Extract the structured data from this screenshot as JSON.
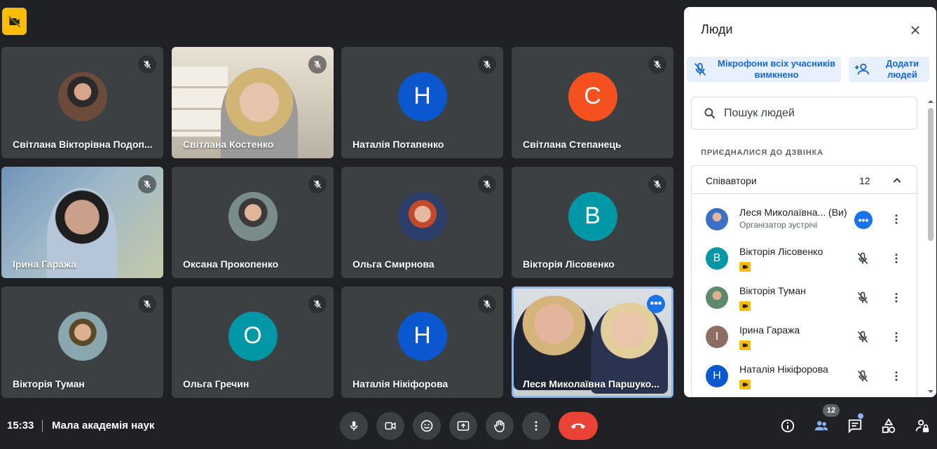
{
  "tiles": [
    {
      "name": "Світлана Вікторівна Подоп...",
      "initial": ""
    },
    {
      "name": "Світлана Костенко",
      "initial": ""
    },
    {
      "name": "Наталія Потапенко",
      "initial": "Н",
      "color": "#0b57d0"
    },
    {
      "name": "Світлана Степанець",
      "initial": "С",
      "color": "#f4511e"
    },
    {
      "name": "Ірина Гаража",
      "initial": ""
    },
    {
      "name": "Оксана Прокопенко",
      "initial": ""
    },
    {
      "name": "Ольга Смирнова",
      "initial": ""
    },
    {
      "name": "Вікторія Лісовенко",
      "initial": "В",
      "color": "#0097a7"
    },
    {
      "name": "Вікторія Туман",
      "initial": ""
    },
    {
      "name": "Ольга Гречин",
      "initial": "О",
      "color": "#0097a7"
    },
    {
      "name": "Наталія Нікіфорова",
      "initial": "Н",
      "color": "#0b57d0"
    },
    {
      "name": "Леся Миколаївна Паршуко...",
      "initial": ""
    }
  ],
  "panel": {
    "title": "Люди",
    "mute_all": "Мікрофони всіх учасників вимкнено",
    "add_people": "Додати людей",
    "search_placeholder": "Пошук людей",
    "section_label": "ПРИЄДНАЛИСЯ ДО ДЗВІНКА",
    "group_title": "Співавтори",
    "group_count": "12",
    "people": [
      {
        "name": "Леся Миколаївна... (Ви)",
        "sub": "Організатор зустрічі",
        "initial": ""
      },
      {
        "name": "Вікторія Лісовенко",
        "initial": "В",
        "color": "#0097a7"
      },
      {
        "name": "Вікторія Туман",
        "initial": ""
      },
      {
        "name": "Ірина Гаража",
        "initial": "І",
        "color": "#8d6e63"
      },
      {
        "name": "Наталія Нікіфорова",
        "initial": "Н",
        "color": "#0b57d0"
      }
    ]
  },
  "bottom": {
    "time": "15:33",
    "meeting_name": "Мала академія наук",
    "participant_count": "12"
  }
}
